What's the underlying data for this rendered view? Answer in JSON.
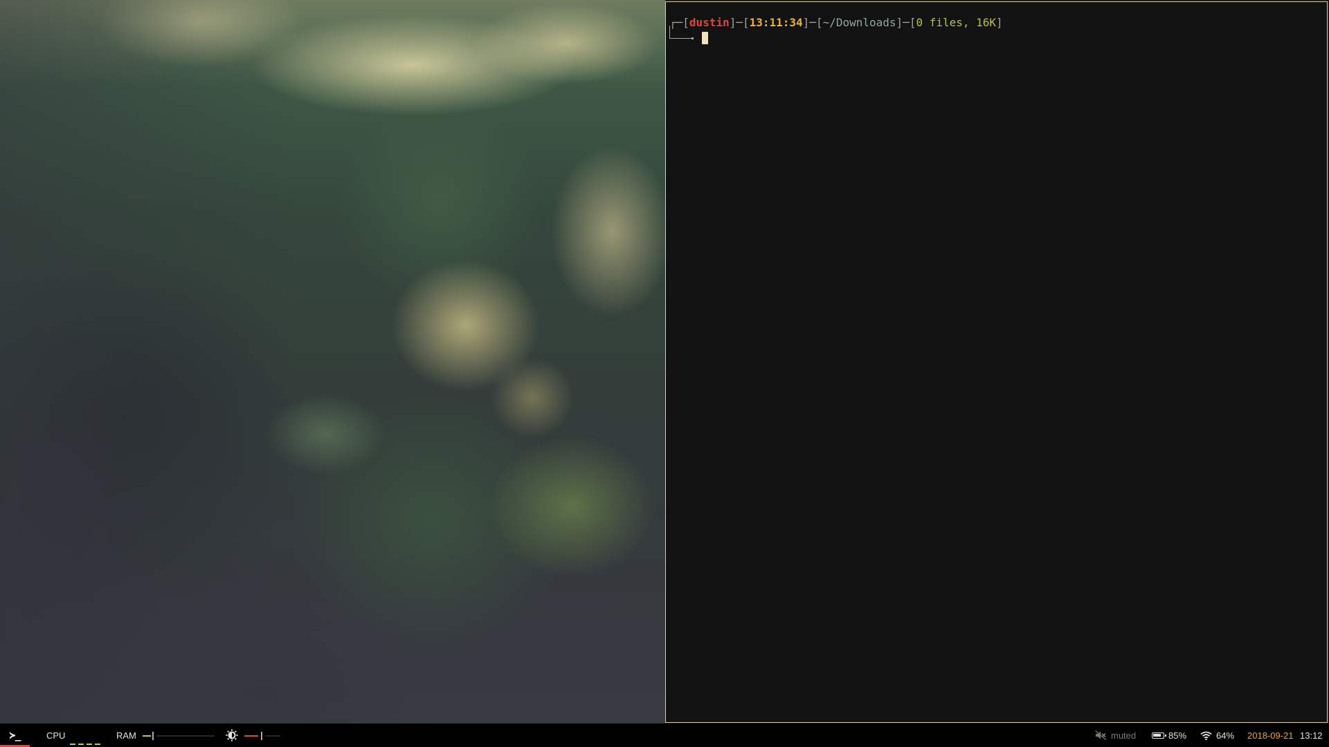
{
  "terminal": {
    "prompt": {
      "open1": "┌─[",
      "user": "dustin",
      "sep1": "]─[",
      "time": "13:11:34",
      "sep2": "]─[",
      "path": "~/Downloads",
      "sep3": "]─[",
      "info": "0 files, 16K",
      "close": "]"
    }
  },
  "statusbar": {
    "launcher_glyph": "≻_",
    "cpu_label": "CPU",
    "ram_label": "RAM",
    "ram_usage": 0.1,
    "brightness_level": 0.3,
    "volume_status": "muted",
    "battery": "85%",
    "battery_level": 0.85,
    "wifi": "64%",
    "date": "2018-09-21",
    "time": "13:12"
  },
  "icons": {
    "launcher": "terminal-prompt-icon",
    "brightness": "brightness-icon",
    "volume": "speaker-muted-icon",
    "battery": "battery-icon",
    "wifi": "wifi-icon"
  },
  "colors": {
    "accent": "#e34a2a",
    "date": "#f0a22a",
    "cpu_meter": "#c5c734",
    "terminal_bg": "#121212",
    "terminal_border": "#d8cfa8"
  }
}
